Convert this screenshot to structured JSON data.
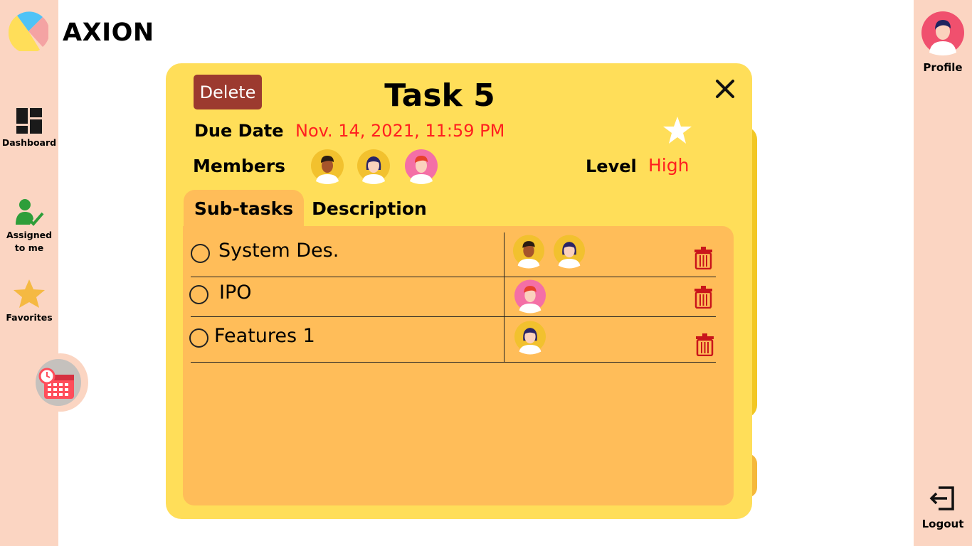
{
  "brand": {
    "name": "AXION"
  },
  "sidebar": {
    "items": [
      {
        "label": "Dashboard",
        "icon": "dashboard-grid-icon"
      },
      {
        "label_line1": "Assigned",
        "label_line2": "to me",
        "icon": "assigned-user-check-icon"
      },
      {
        "label": "Favorites",
        "icon": "star-icon"
      }
    ],
    "calendar_icon": "calendar-clock-icon"
  },
  "right_rail": {
    "profile_label": "Profile",
    "logout_label": "Logout"
  },
  "task": {
    "delete_label": "Delete",
    "title": "Task 5",
    "due_label": "Due Date",
    "due_value": "Nov.  14, 2021, 11:59 PM",
    "members_label": "Members",
    "level_label": "Level",
    "level_value": "High",
    "members": [
      "member-avatar-man",
      "member-avatar-woman",
      "member-avatar-redhead"
    ],
    "tabs": [
      {
        "label": "Sub-tasks",
        "active": true
      },
      {
        "label": "Description",
        "active": false
      }
    ],
    "subtasks": [
      {
        "name": "System Des.",
        "assignees": [
          "man",
          "woman"
        ]
      },
      {
        "name": "IPO",
        "assignees": [
          "redhead"
        ]
      },
      {
        "name": "Features 1",
        "assignees": [
          "woman"
        ]
      }
    ]
  },
  "colors": {
    "rail": "#fbd5c2",
    "card": "#ffde59",
    "panel": "#ffbd59",
    "delete": "#9c3a2f",
    "accent_red": "#ff1f1f"
  }
}
